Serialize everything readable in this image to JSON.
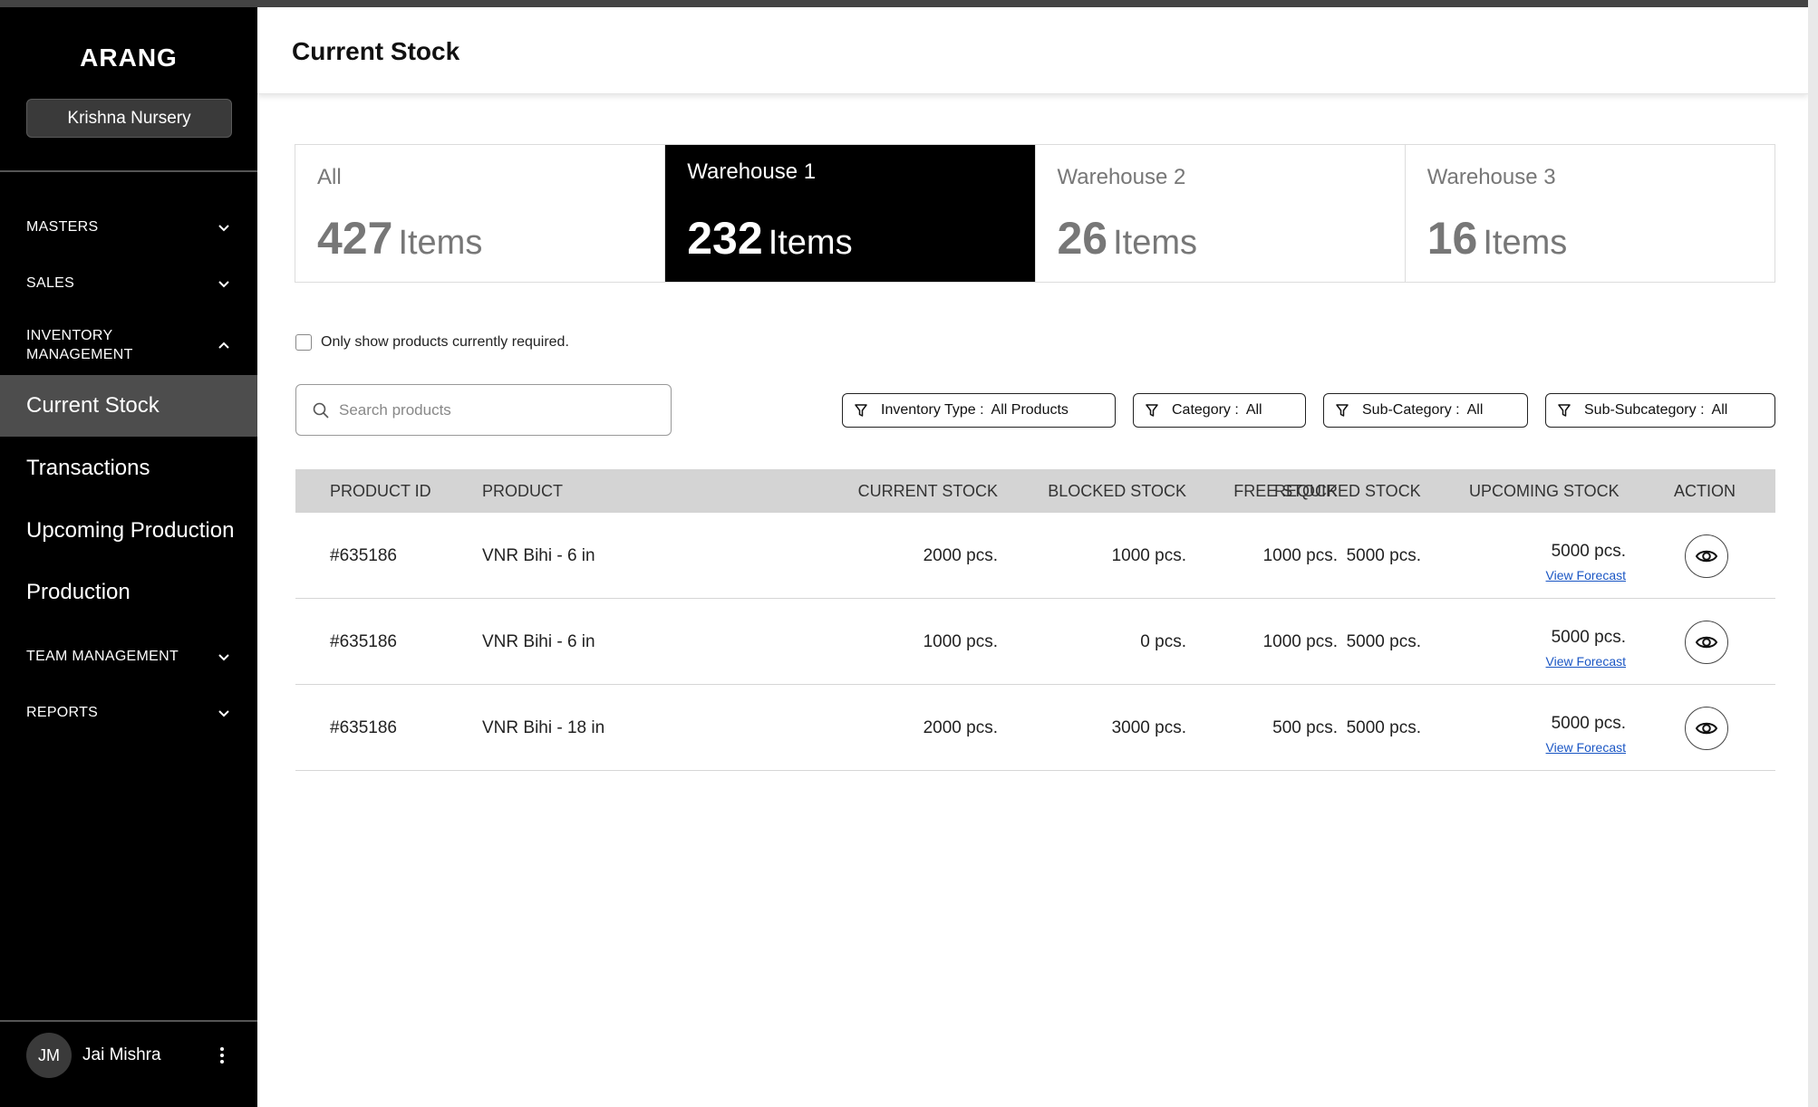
{
  "sidebar": {
    "brand": "ARANG",
    "org": "Krishna Nursery",
    "groups": {
      "masters": "MASTERS",
      "sales": "SALES",
      "inventory_line1": "INVENTORY",
      "inventory_line2": "MANAGEMENT",
      "team": "TEAM MANAGEMENT",
      "reports": "REPORTS"
    },
    "items": [
      "Current Stock",
      "Transactions",
      "Upcoming Production",
      "Production"
    ],
    "user": {
      "initials": "JM",
      "name": "Jai Mishra"
    }
  },
  "header": {
    "title": "Current Stock"
  },
  "warehouses": [
    {
      "label": "All",
      "count": "427",
      "unit": "Items"
    },
    {
      "label": "Warehouse 1",
      "count": "232",
      "unit": "Items"
    },
    {
      "label": "Warehouse 2",
      "count": "26",
      "unit": "Items"
    },
    {
      "label": "Warehouse 3",
      "count": "16",
      "unit": "Items"
    }
  ],
  "filters_bar": {
    "checkbox_label": "Only show products currently required.",
    "search_placeholder": "Search products",
    "filters": [
      {
        "label": "Inventory Type :",
        "value": "All Products"
      },
      {
        "label": "Category :",
        "value": "All"
      },
      {
        "label": "Sub-Category :",
        "value": "All"
      },
      {
        "label": "Sub-Subcategory :",
        "value": "All"
      }
    ]
  },
  "table": {
    "columns": [
      "PRODUCT ID",
      "PRODUCT",
      "CURRENT STOCK",
      "BLOCKED STOCK",
      "FREE STOCK",
      "REQUIRED STOCK",
      "UPCOMING STOCK",
      "ACTION"
    ],
    "link_label": "View Forecast",
    "rows": [
      {
        "id": "#635186",
        "product": "VNR Bihi - 6 in",
        "current": "2000 pcs.",
        "blocked": "1000 pcs.",
        "free": "1000 pcs.",
        "required": "5000 pcs.",
        "upcoming": "5000 pcs."
      },
      {
        "id": "#635186",
        "product": "VNR Bihi - 6 in",
        "current": "1000 pcs.",
        "blocked": "0 pcs.",
        "free": "1000 pcs.",
        "required": "5000 pcs.",
        "upcoming": "5000 pcs."
      },
      {
        "id": "#635186",
        "product": "VNR Bihi - 18 in",
        "current": "2000 pcs.",
        "blocked": "3000 pcs.",
        "free": "500 pcs.",
        "required": "5000 pcs.",
        "upcoming": "5000 pcs."
      }
    ]
  },
  "icons": {
    "chevron": "chevron-down-icon",
    "chevron_up": "chevron-up-icon",
    "search": "search-icon",
    "filter": "filter-icon",
    "eye": "eye-icon",
    "menu": "kebab-menu-icon"
  },
  "colors": {
    "sidebar_bg": "#000000",
    "active_nav": "#4d4d4d",
    "active_card": "#000000",
    "link": "#1a56c4",
    "table_header": "#d4d4d4"
  }
}
